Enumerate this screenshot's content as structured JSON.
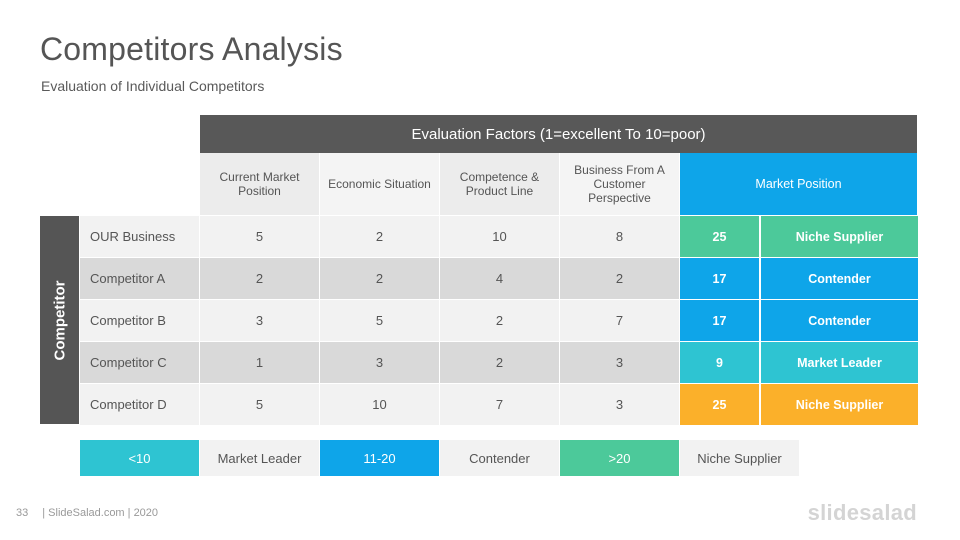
{
  "title": "Competitors Analysis",
  "subtitle": "Evaluation of Individual Competitors",
  "factors_header": "Evaluation Factors (1=excellent To 10=poor)",
  "columns": [
    "Current Market Position",
    "Economic Situation",
    "Competence & Product Line",
    "Business From A Customer Perspective"
  ],
  "market_position_header": "Market Position",
  "competitor_label": "Competitor",
  "rows": [
    {
      "name": "OUR Business",
      "values": [
        "5",
        "2",
        "10",
        "8"
      ],
      "score": "25",
      "position": "Niche Supplier",
      "color": "#4cc99a"
    },
    {
      "name": "Competitor  A",
      "values": [
        "2",
        "2",
        "4",
        "2"
      ],
      "score": "17",
      "position": "Contender",
      "color": "#0ea5e9"
    },
    {
      "name": "Competitor  B",
      "values": [
        "3",
        "5",
        "2",
        "7"
      ],
      "score": "17",
      "position": "Contender",
      "color": "#0ea5e9"
    },
    {
      "name": "Competitor  C",
      "values": [
        "1",
        "3",
        "2",
        "3"
      ],
      "score": "9",
      "position": "Market Leader",
      "color": "#2ec4d2"
    },
    {
      "name": "Competitor  D",
      "values": [
        "5",
        "10",
        "7",
        "3"
      ],
      "score": "25",
      "position": "Niche Supplier",
      "color": "#fbb02a"
    }
  ],
  "legend": [
    {
      "range": "<10",
      "label": "Market Leader",
      "color": "#2ec4d2"
    },
    {
      "range": "11-20",
      "label": "Contender",
      "color": "#0ea5e9"
    },
    {
      "range": ">20",
      "label": "Niche Supplier",
      "color": "#4cc99a"
    }
  ],
  "footer": {
    "page_number": "33",
    "text": "| SlideSalad.com | 2020"
  },
  "brand": "slidesalad"
}
